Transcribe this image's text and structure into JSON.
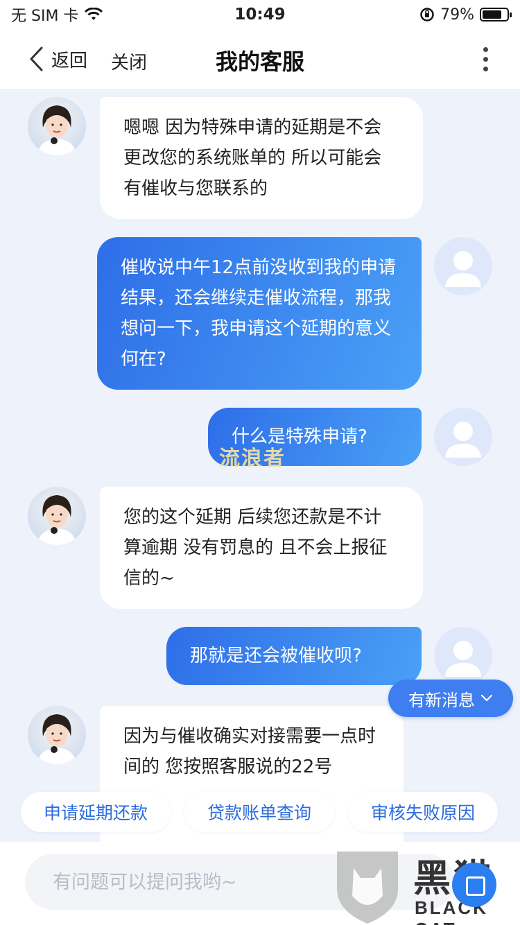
{
  "status_bar": {
    "carrier": "无 SIM 卡",
    "time": "10:49",
    "battery": "79%",
    "battery_level": 0.79
  },
  "nav": {
    "back_label": "返回",
    "close_label": "关闭",
    "title": "我的客服"
  },
  "messages": [
    {
      "from": "agent",
      "text": "嗯嗯 因为特殊申请的延期是不会更改您的系统账单的 所以可能会有催收与您联系的"
    },
    {
      "from": "user",
      "text": "催收说中午12点前没收到我的申请结果，还会继续走催收流程，那我想问一下，我申请这个延期的意义何在?"
    },
    {
      "from": "user",
      "text": "什么是特殊申请?"
    },
    {
      "from": "agent",
      "text": "您的这个延期 后续您还款是不计算逾期 没有罚息的 且不会上报征信的~"
    },
    {
      "from": "user",
      "text": "那就是还会被催收呗?"
    },
    {
      "from": "agent",
      "text": "因为与催收确实对接需要一点时间的 您按照客服说的22号"
    }
  ],
  "watermark": "流浪者",
  "new_message_label": "有新消息",
  "quick_replies": [
    "申请延期还款",
    "贷款账单查询",
    "审核失败原因"
  ],
  "input": {
    "placeholder": "有问题可以提问我哟~"
  },
  "branding": {
    "cn": "黑猫",
    "en": "BLACK CAT"
  }
}
